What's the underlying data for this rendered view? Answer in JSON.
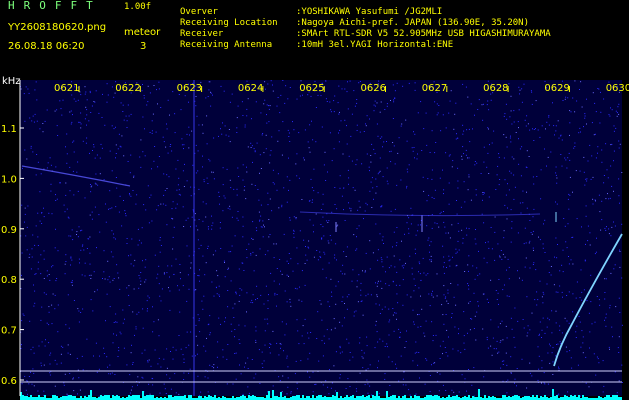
{
  "header": {
    "title": "HROFFT",
    "version": "1.00f",
    "filename": "YY2608180620.png",
    "datetime": "26.08.18 06:20",
    "meteor_label": "meteor",
    "meteor_count": "3"
  },
  "station": [
    {
      "label": "Overver",
      "value": ":YOSHIKAWA Yasufumi /JG2MLI"
    },
    {
      "label": "Receiving Location",
      "value": ":Nagoya Aichi-pref. JAPAN (136.90E, 35.20N)"
    },
    {
      "label": "Receiver",
      "value": ":SMArt RTL-SDR V5 52.905MHz USB HIGASHIMURAYAMA"
    },
    {
      "label": "Receiving Antenna",
      "value": ":10mH 3el.YAGI Horizontal:ENE"
    }
  ],
  "chart_data": {
    "type": "heatmap",
    "ylabel": "kHz",
    "ylim": [
      0.6,
      1.15
    ],
    "y_ticks": [
      "1.1",
      "1.0",
      "0.9",
      "0.8",
      "0.7",
      "0.6"
    ],
    "x_ticks": [
      "0621",
      "0622",
      "0623",
      "0624",
      "0625",
      "0626",
      "0627",
      "0628",
      "0629",
      "0630"
    ],
    "colors": {
      "background": "#00003a",
      "noise": "#2a2aff",
      "echo": "#7fd4ff",
      "baseline": "#00ffff",
      "tick_text": "#ffff00",
      "axis": "#ffffff"
    }
  }
}
